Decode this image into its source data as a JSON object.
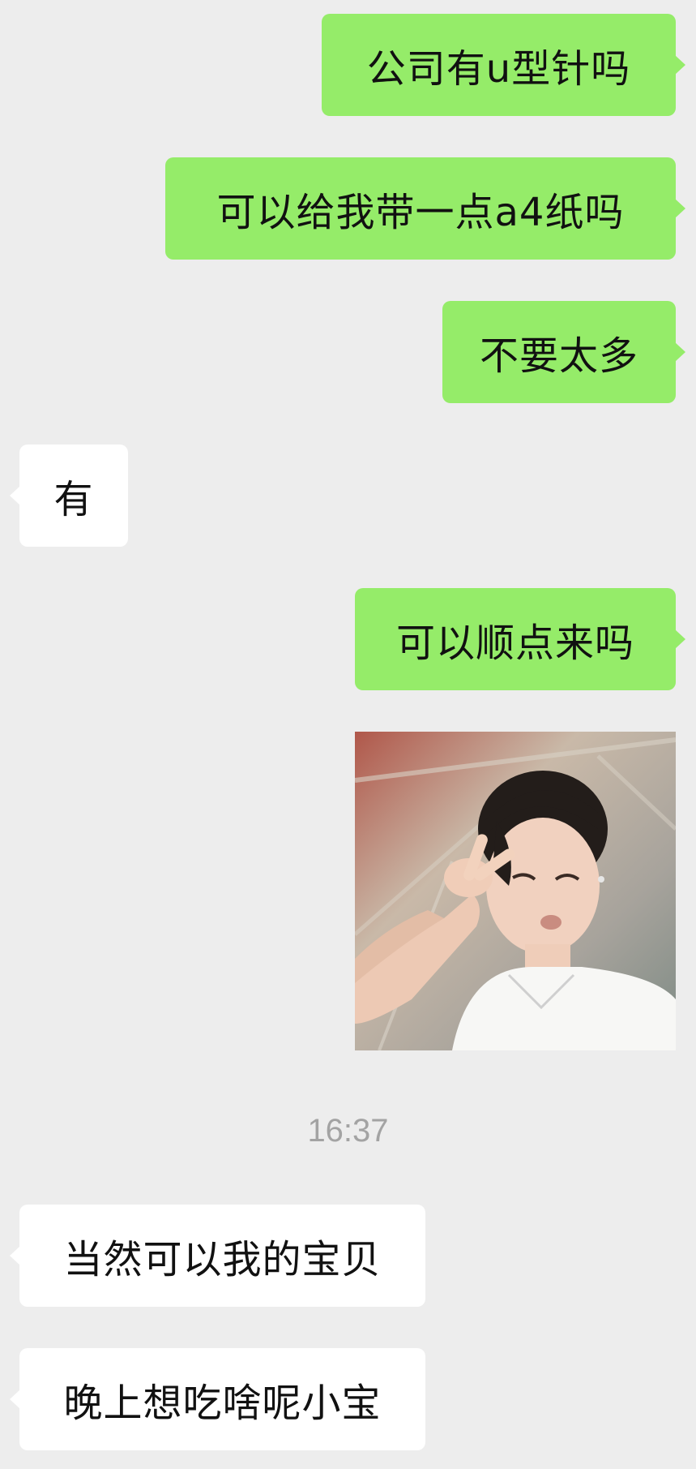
{
  "colors": {
    "background": "#ededed",
    "my_bubble": "#95ec69",
    "their_bubble": "#ffffff",
    "timestamp_text": "#a3a3a3"
  },
  "messages": [
    {
      "sender": "me",
      "type": "text",
      "text": "公司有u型针吗"
    },
    {
      "sender": "me",
      "type": "text",
      "text": "可以给我带一点a4纸吗"
    },
    {
      "sender": "me",
      "type": "text",
      "text": "不要太多"
    },
    {
      "sender": "them",
      "type": "text",
      "text": "有"
    },
    {
      "sender": "me",
      "type": "text",
      "text": "可以顺点来吗"
    },
    {
      "sender": "me",
      "type": "image",
      "icon": "photo-sticker"
    },
    {
      "type": "timestamp",
      "text": "16:37"
    },
    {
      "sender": "them",
      "type": "text",
      "text": "当然可以我的宝贝"
    },
    {
      "sender": "them",
      "type": "text",
      "text": "晚上想吃啥呢小宝"
    }
  ]
}
